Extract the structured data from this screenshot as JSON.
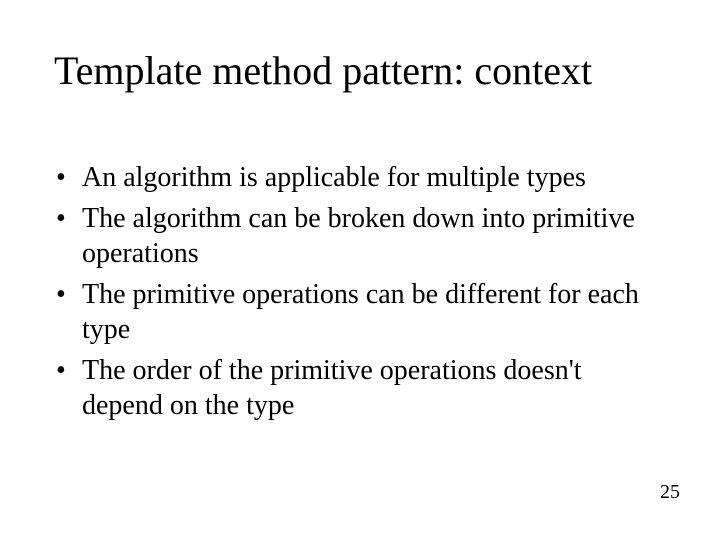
{
  "slide": {
    "title": "Template method pattern: context",
    "bullets": [
      "An algorithm is applicable for multiple types",
      "The algorithm can be broken down into primitive operations",
      "The primitive operations can be different for each type",
      "The order of the primitive operations doesn't depend on the type"
    ],
    "page_number": "25"
  }
}
